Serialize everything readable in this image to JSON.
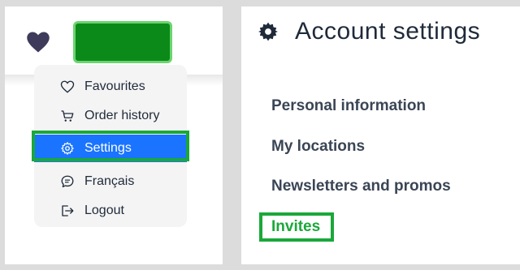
{
  "dropdown": {
    "items": [
      {
        "label": "Favourites",
        "icon": "heart-outline-icon"
      },
      {
        "label": "Order history",
        "icon": "cart-icon"
      },
      {
        "label": "Settings",
        "icon": "gear-icon",
        "active": true
      },
      {
        "label": "Français",
        "icon": "speech-bubble-icon"
      },
      {
        "label": "Logout",
        "icon": "logout-icon"
      }
    ]
  },
  "settings": {
    "title": "Account settings",
    "links": [
      {
        "label": "Personal information"
      },
      {
        "label": "My locations"
      },
      {
        "label": "Newsletters and promos"
      },
      {
        "label": "Invites",
        "active": true
      }
    ]
  },
  "colors": {
    "accent_blue": "#1a74ff",
    "highlight_green": "#1aa83a",
    "button_green": "#0b8a1a",
    "heart": "#3d3a5a",
    "text": "#1f2a3a"
  }
}
